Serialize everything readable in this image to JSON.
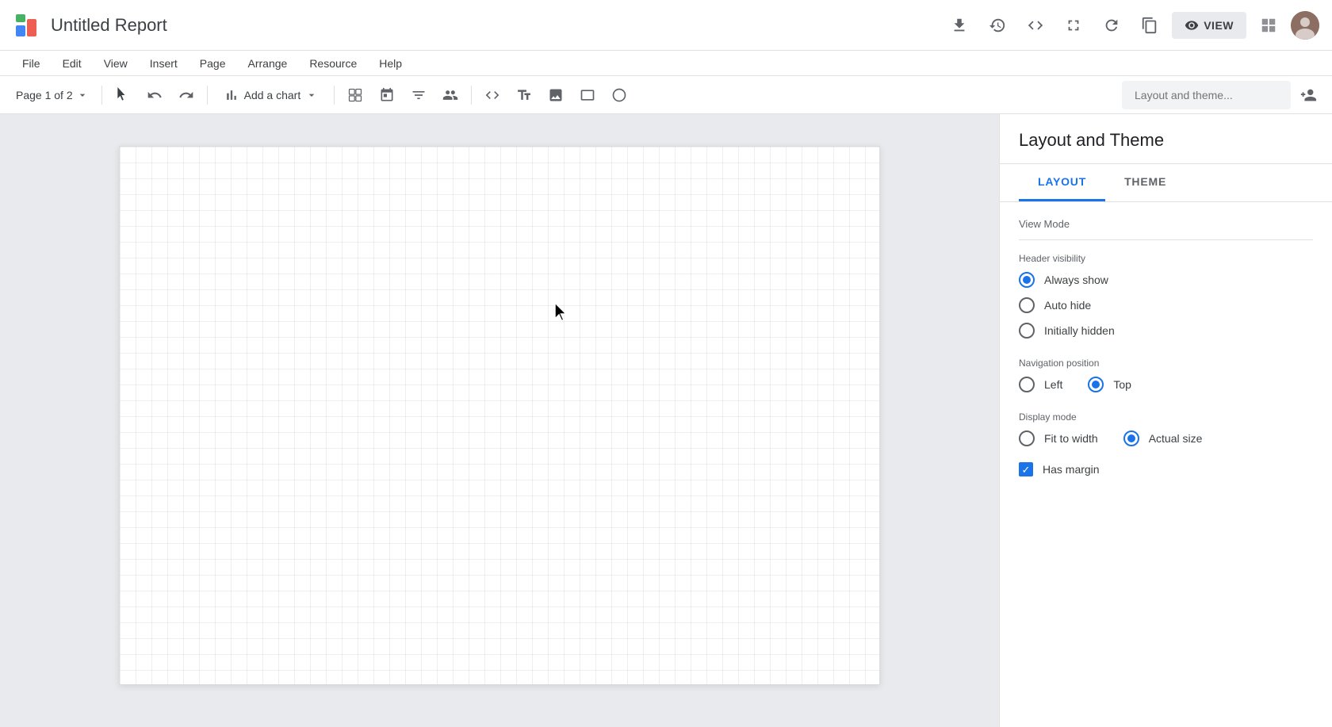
{
  "app": {
    "title": "Untitled Report",
    "logo_label": "Looker Studio logo"
  },
  "header": {
    "view_button": "VIEW",
    "download_icon": "download-icon",
    "history_icon": "history-icon",
    "code_icon": "code-icon",
    "fullscreen_icon": "fullscreen-icon",
    "refresh_icon": "refresh-icon",
    "copy_icon": "copy-icon",
    "grid_icon": "grid-icon"
  },
  "menubar": {
    "items": [
      "File",
      "Edit",
      "View",
      "Insert",
      "Page",
      "Arrange",
      "Resource",
      "Help"
    ]
  },
  "toolbar": {
    "page_label": "Page 1 of 2",
    "add_chart_label": "Add a chart",
    "layout_theme_placeholder": "Layout and theme...",
    "add_user_icon": "add-user-icon"
  },
  "panel": {
    "title": "Layout and Theme",
    "tabs": [
      "LAYOUT",
      "THEME"
    ],
    "active_tab": 0,
    "view_mode_label": "View Mode",
    "header_visibility_label": "Header visibility",
    "header_options": [
      "Always show",
      "Auto hide",
      "Initially hidden"
    ],
    "header_selected": 0,
    "navigation_position_label": "Navigation position",
    "nav_options": [
      "Left",
      "Top"
    ],
    "nav_selected": 1,
    "display_mode_label": "Display mode",
    "display_options": [
      "Fit to width",
      "Actual size"
    ],
    "display_selected": 1,
    "has_margin_label": "Has margin",
    "has_margin_checked": true
  }
}
